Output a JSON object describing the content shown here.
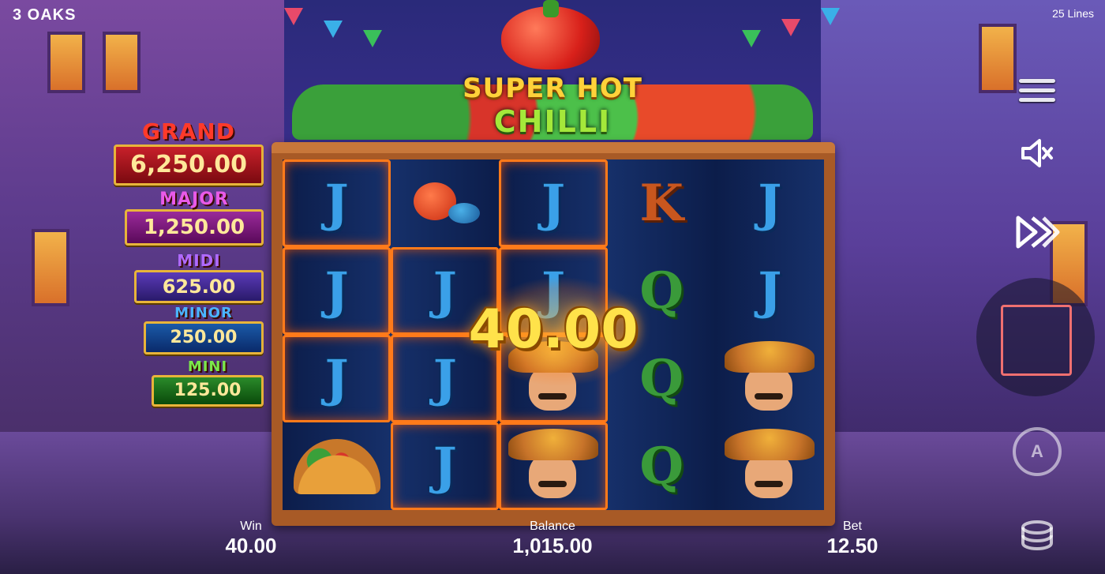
{
  "header": {
    "brand": "3 OAKS",
    "lines": "25 Lines"
  },
  "logo": {
    "line1": "SUPER HOT",
    "line2": "CHILLI"
  },
  "jackpots": {
    "grand": {
      "label": "GRAND",
      "value": "6,250.00"
    },
    "major": {
      "label": "MAJOR",
      "value": "1,250.00"
    },
    "midi": {
      "label": "MIDI",
      "value": "625.00"
    },
    "minor": {
      "label": "MINOR",
      "value": "250.00"
    },
    "mini": {
      "label": "MINI",
      "value": "125.00"
    }
  },
  "reels": {
    "win_display": "40.00",
    "grid": [
      [
        "J",
        "maracas",
        "J",
        "K",
        "J"
      ],
      [
        "J",
        "J",
        "J",
        "Q",
        "J"
      ],
      [
        "J",
        "J",
        "mariachi",
        "Q",
        "mariachi"
      ],
      [
        "taco",
        "J",
        "mariachi",
        "Q",
        "mariachi"
      ]
    ]
  },
  "footer": {
    "win_label": "Win",
    "win_value": "40.00",
    "balance_label": "Balance",
    "balance_value": "1,015.00",
    "bet_label": "Bet",
    "bet_value": "12.50"
  },
  "controls": {
    "auto_label": "A"
  },
  "icons": [
    "menu-icon",
    "sound-off-icon",
    "fast-forward-icon",
    "spin-icon",
    "autoplay-icon",
    "coins-stack-icon"
  ]
}
